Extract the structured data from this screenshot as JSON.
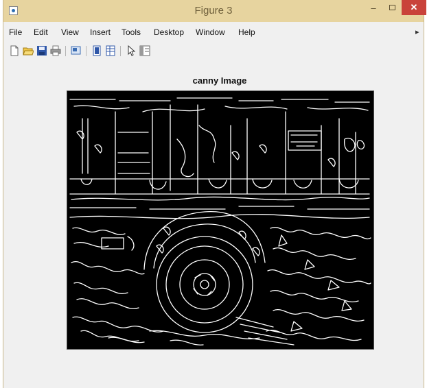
{
  "window": {
    "title": "Figure 3",
    "controls": {
      "minimize": "–",
      "close": "✕"
    }
  },
  "menubar": {
    "items": [
      "File",
      "Edit",
      "View",
      "Insert",
      "Tools",
      "Desktop",
      "Window",
      "Help"
    ]
  },
  "toolbar": {
    "icons": [
      "new-figure-icon",
      "open-file-icon",
      "save-icon",
      "print-icon",
      "print-preview-icon",
      "link-plot-icon",
      "insert-colorbar-icon",
      "edit-plot-icon",
      "show-plot-tools-icon"
    ]
  },
  "axes": {
    "title": "canny Image"
  },
  "colors": {
    "titlebar": "#e7d49f",
    "close_button": "#c9423a",
    "image_background": "#000000",
    "edges": "#ffffff"
  }
}
